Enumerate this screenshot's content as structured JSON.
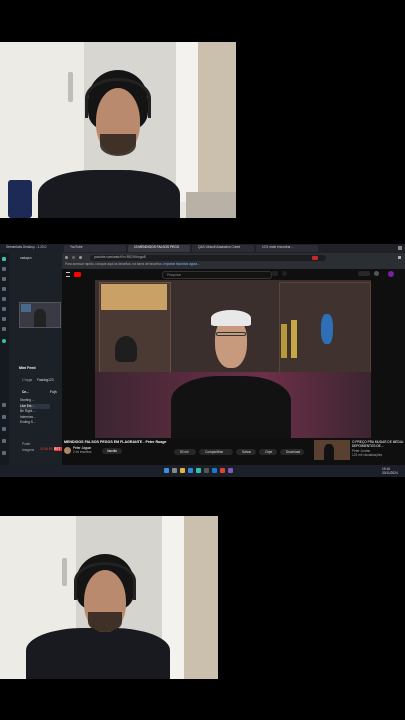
{
  "obs": {
    "app_title": "Streamlabs Desktop - 1.20.0",
    "profile": "vadapro",
    "mini_feed_title": "Mini Feed",
    "mini_feed_filter": "1 lvpge",
    "mini_feed_user": "Fasking123",
    "scenes_label": "Ce...",
    "sources_label": "Fo(h",
    "scene_items": [
      "Starting ...",
      "Live Ext...",
      "Be Right ...",
      "Intermiss...",
      "Ending S..."
    ],
    "footer_items": [
      "Poder",
      "Imagens"
    ],
    "live_time": "01:56:09",
    "live_label": "RST",
    "accent": "#31c3a2"
  },
  "browser": {
    "tabs": [
      {
        "label": "YouTube",
        "active": false
      },
      {
        "label": "10 MENDIGOS FALSOS PEGO",
        "active": true
      },
      {
        "label": "Q&S Ubisoft Assassins Creed",
        "active": false
      },
      {
        "label": "10 5 onde encontrar ...",
        "active": false
      }
    ],
    "url": "youtube.com/watch?v=RICVKfurgo8",
    "bookmark_text": "Para acessar rápido, coloque aqui os favoritos, na barra de favoritos.",
    "bookmark_link": "Importar favoritos agora..."
  },
  "youtube": {
    "search_placeholder": "Pesquisar",
    "video_title": "MENDIGOS FALSOS PEGOS EM FLAGRANTE - Peter Ruage",
    "channel": "Peter Jaguar",
    "subscribers": "2 mi inscritos",
    "subscribe_label": "Inscrito",
    "like_count": "50 mil",
    "actions": [
      "Compartilhar",
      "Salvar",
      "Clipe",
      "Download"
    ],
    "recommended_title": "O PREÇO PRA MUDAR DE MEDIA: DEPOIMENTOS DE...",
    "recommended_channel": "Peter Jordan",
    "recommended_meta": "123 mil visualizações"
  },
  "taskbar": {
    "time": "19:16",
    "date": "20/11/2024"
  }
}
